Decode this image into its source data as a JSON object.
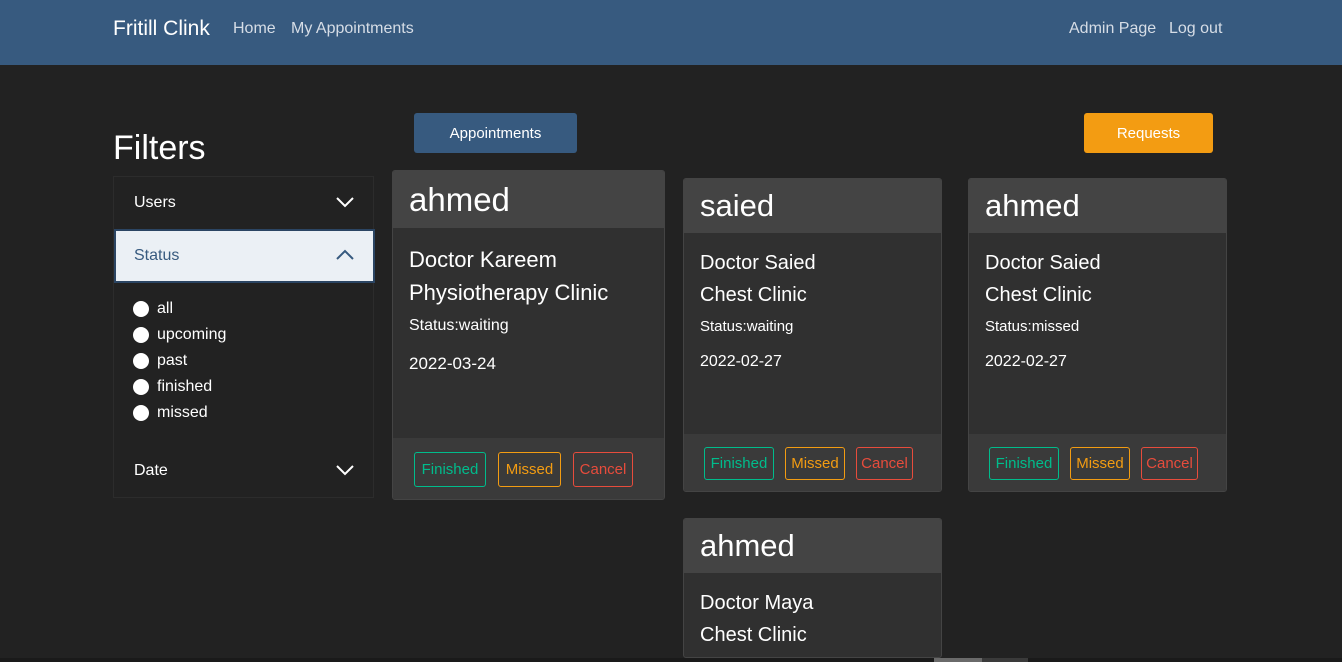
{
  "nav": {
    "brand": "Fritill Clink",
    "home": "Home",
    "my_appointments": "My Appointments",
    "admin_page": "Admin Page",
    "log_out": "Log out"
  },
  "filters": {
    "title": "Filters",
    "users_label": "Users",
    "status_label": "Status",
    "date_label": "Date",
    "status_options": [
      "all",
      "upcoming",
      "past",
      "finished",
      "missed"
    ]
  },
  "tabs": {
    "appointments": "Appointments",
    "requests": "Requests"
  },
  "actions": {
    "finished": "Finished",
    "missed": "Missed",
    "cancel": "Cancel"
  },
  "cards": [
    {
      "name": "ahmed",
      "doctor": "Doctor Kareem",
      "clinic": "Physiotherapy Clinic",
      "status": "Status:waiting",
      "date": "2022-03-24"
    },
    {
      "name": "saied",
      "doctor": "Doctor Saied",
      "clinic": "Chest Clinic",
      "status": "Status:waiting",
      "date": "2022-02-27"
    },
    {
      "name": "ahmed",
      "doctor": "Doctor Saied",
      "clinic": "Chest Clinic",
      "status": "Status:missed",
      "date": "2022-02-27"
    },
    {
      "name": "ahmed",
      "doctor": "Doctor Maya",
      "clinic": "Chest Clinic"
    }
  ],
  "colors": {
    "navbar": "#375a7f",
    "background": "#222222",
    "success": "#00bc8c",
    "warning": "#f39c12",
    "danger": "#e74c3c"
  }
}
